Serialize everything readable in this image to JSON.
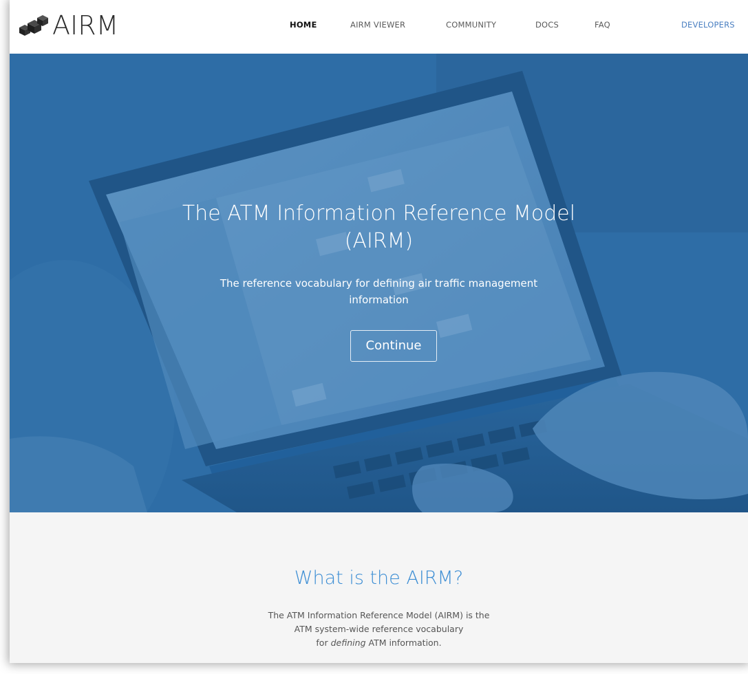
{
  "brand": {
    "name": "AIRM"
  },
  "nav": {
    "items": [
      {
        "label": "HOME",
        "active": true
      },
      {
        "label": "AIRM VIEWER",
        "active": false
      },
      {
        "label": "COMMUNITY",
        "active": false
      },
      {
        "label": "DOCS",
        "active": false
      },
      {
        "label": "FAQ",
        "active": false
      },
      {
        "label": "DEVELOPERS",
        "active": false
      }
    ]
  },
  "hero": {
    "title_line1": "The ATM Information Reference Model",
    "title_line2": "(AIRM)",
    "subtitle_line1": "The reference vocabulary for defining air traffic management",
    "subtitle_line2": "information",
    "button_label": "Continue"
  },
  "about": {
    "title": "What is the AIRM?",
    "line1": "The ATM Information Reference Model (AIRM) is the",
    "line2": "ATM system-wide reference vocabulary",
    "line3_prefix": "for ",
    "line3_emphasis": "defining",
    "line3_suffix": " ATM information."
  },
  "colors": {
    "hero_overlay": "#2f6fa8",
    "accent": "#3d8ed4",
    "nav_developers": "#4a7fc1",
    "section_bg": "#f5f5f5"
  },
  "icons": {
    "logo": "stacked-cubes-icon"
  }
}
